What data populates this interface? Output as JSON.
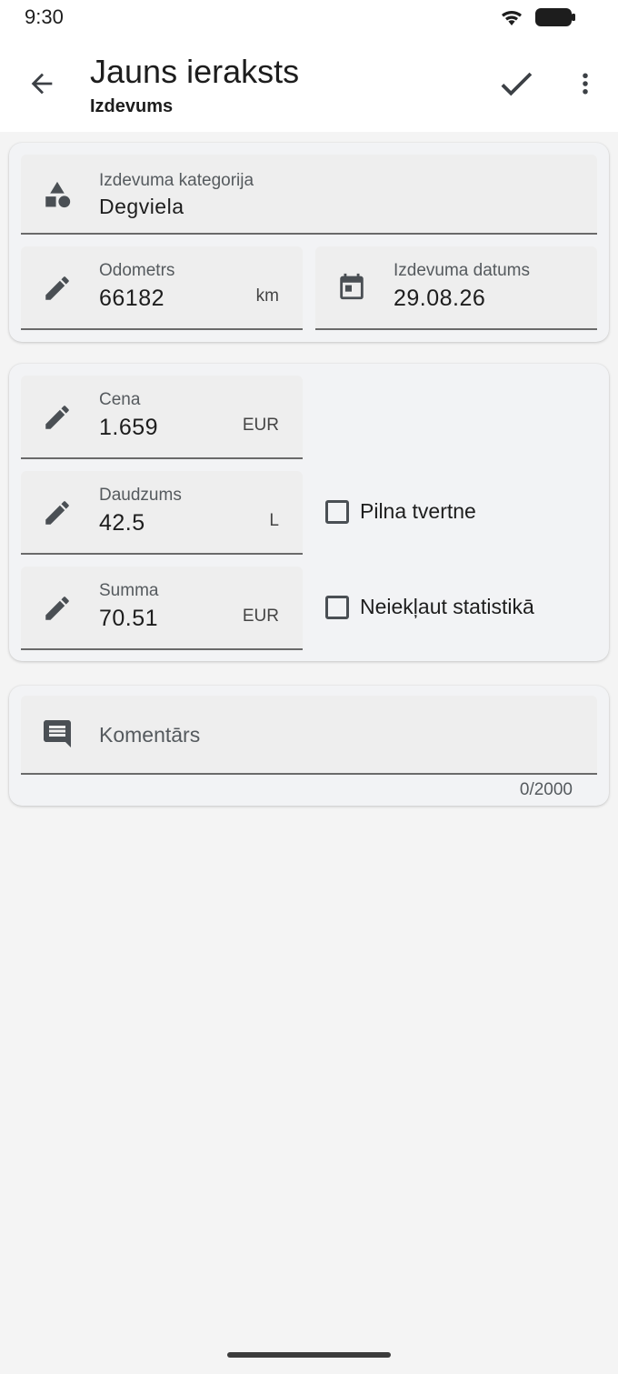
{
  "status_bar": {
    "time": "9:30",
    "icons": [
      "wifi-icon",
      "battery-icon"
    ]
  },
  "app_bar": {
    "title": "Jauns ieraksts",
    "subtitle": "Izdevums",
    "icons": [
      "arrow-back-icon",
      "check-icon",
      "more-vert-icon"
    ]
  },
  "card_details": {
    "category": {
      "label": "Izdevuma kategorija",
      "value": "Degviela",
      "icon": "category-shapes-icon"
    },
    "odometer": {
      "label": "Odometrs",
      "value": "66182",
      "unit": "km",
      "icon": "pencil-icon"
    },
    "date": {
      "label": "Izdevuma datums",
      "value": "29.08.26",
      "icon": "calendar-icon"
    }
  },
  "card_amounts": {
    "price": {
      "label": "Cena",
      "value": "1.659",
      "unit": "EUR",
      "icon": "pencil-icon"
    },
    "quantity": {
      "label": "Daudzums",
      "value": "42.5",
      "unit": "L",
      "icon": "pencil-icon"
    },
    "sum": {
      "label": "Summa",
      "value": "70.51",
      "unit": "EUR",
      "icon": "pencil-icon"
    },
    "full_tank": {
      "label": "Pilna tvertne",
      "checked": false
    },
    "exclude_stats": {
      "label": "Neiekļaut statistikā",
      "checked": false
    }
  },
  "card_comment": {
    "placeholder": "Komentārs",
    "counter": "0/2000",
    "icon": "comment-icon"
  },
  "colors": {
    "background": "#f4f4f4",
    "card": "#f2f3f5",
    "field": "#eeeeee",
    "icon": "#4a4f54",
    "text": "#1d1d1d",
    "label": "#555a5e"
  }
}
